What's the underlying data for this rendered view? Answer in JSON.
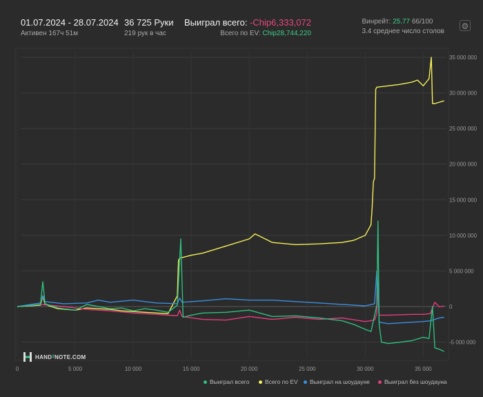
{
  "header": {
    "date_range": "01.07.2024 - 28.07.2024",
    "active_time": "Активен 167ч 51м",
    "hands_count": "36 725 Руки",
    "hands_per_hour": "219 рук в час",
    "won_total_label": "Выиграл всего: ",
    "won_total_value": "-Chip6,333,072",
    "ev_total_label": "Всего по EV: ",
    "ev_total_value": "Chip28,744,220",
    "winrate_label": "Винрейт: ",
    "winrate_value": "25.77",
    "winrate_suffix": " 66/100",
    "avg_tables": "3.4 среднее число столов"
  },
  "logo": {
    "text_a": "HAND",
    "text_b": "2",
    "text_c": "NOTE.COM"
  },
  "colors": {
    "won_total": "#2fbf7f",
    "ev_total": "#f5f05a",
    "showdown": "#3b8fe0",
    "non_showdown": "#e63d7d"
  },
  "icons": {
    "settings": "gear-icon"
  },
  "chart_data": {
    "type": "line",
    "xlim": [
      0,
      37000
    ],
    "ylim": [
      -6000000,
      35000000
    ],
    "x_ticks": [
      "0",
      "5 000",
      "10 000",
      "15 000",
      "20 000",
      "25 000",
      "30 000",
      "35 000"
    ],
    "x_tick_values": [
      0,
      5000,
      10000,
      15000,
      20000,
      25000,
      30000,
      35000
    ],
    "y_ticks": [
      "35 000 000",
      "30 000 000",
      "25 000 000",
      "20 000 000",
      "15 000 000",
      "10 000 000",
      "5 000 000",
      "0",
      "-5 000 000"
    ],
    "y_tick_values": [
      35000000,
      30000000,
      25000000,
      20000000,
      15000000,
      10000000,
      5000000,
      0,
      -5000000
    ],
    "grid": true,
    "legend_position": "bottom-right",
    "series": [
      {
        "name": "Выиграл всего",
        "color": "#2fbf7f",
        "x": [
          0,
          1500,
          2000,
          2200,
          2400,
          3500,
          5000,
          6000,
          8000,
          9000,
          10000,
          11000,
          12000,
          13000,
          13800,
          14100,
          14300,
          15000,
          16000,
          18000,
          20000,
          22000,
          24000,
          26000,
          28000,
          29000,
          30000,
          30500,
          31000,
          31100,
          31200,
          31400,
          32000,
          33000,
          34000,
          35000,
          35500,
          35800,
          36000,
          36400,
          36800
        ],
        "y": [
          0,
          200000,
          300000,
          3500000,
          400000,
          -200000,
          -500000,
          300000,
          -300000,
          -200000,
          -600000,
          -300000,
          -500000,
          -800000,
          200000,
          9500000,
          -1500000,
          -1200000,
          -900000,
          -800000,
          -500000,
          -1400000,
          -1300000,
          -1600000,
          -2000000,
          -2500000,
          -3200000,
          -3500000,
          200000,
          12000000,
          -2500000,
          -5000000,
          -5200000,
          -5000000,
          -4800000,
          -4300000,
          -4500000,
          0,
          -5800000,
          -6000000,
          -6300000
        ]
      },
      {
        "name": "Всего по EV",
        "color": "#f5f05a",
        "x": [
          0,
          1500,
          2000,
          2200,
          2400,
          3500,
          5000,
          6000,
          8000,
          9000,
          10000,
          11000,
          12000,
          13000,
          13800,
          13900,
          14000,
          15000,
          16000,
          18000,
          20000,
          20500,
          21000,
          22000,
          24000,
          26000,
          28000,
          29000,
          30000,
          30500,
          30600,
          30700,
          30800,
          30900,
          31000,
          32000,
          33000,
          34000,
          34500,
          35000,
          35500,
          35700,
          35800,
          36000,
          36400,
          36800
        ],
        "y": [
          0,
          150000,
          200000,
          1500000,
          300000,
          -300000,
          -500000,
          -200000,
          -400000,
          -600000,
          -700000,
          -800000,
          -900000,
          -1000000,
          1500000,
          6500000,
          6800000,
          7200000,
          7500000,
          8500000,
          9500000,
          10200000,
          9800000,
          9000000,
          8700000,
          8800000,
          9000000,
          9300000,
          10000000,
          11500000,
          14000000,
          17500000,
          18000000,
          30500000,
          30800000,
          31000000,
          31200000,
          31500000,
          31800000,
          31000000,
          32000000,
          35000000,
          28500000,
          28500000,
          28700000,
          28900000
        ]
      },
      {
        "name": "Выиграл на шоудауне",
        "color": "#3b8fe0",
        "x": [
          0,
          2000,
          2200,
          2400,
          4000,
          6000,
          7000,
          8000,
          10000,
          11000,
          12000,
          13800,
          14000,
          14200,
          16000,
          18000,
          20000,
          22000,
          24000,
          26000,
          28000,
          30000,
          30800,
          31000,
          31100,
          31200,
          32000,
          34000,
          35000,
          35600,
          36000,
          36400,
          36800
        ],
        "y": [
          0,
          500000,
          1500000,
          700000,
          400000,
          500000,
          900000,
          600000,
          900000,
          700000,
          500000,
          400000,
          1200000,
          600000,
          800000,
          1100000,
          900000,
          900000,
          700000,
          500000,
          300000,
          100000,
          400000,
          5000000,
          2800000,
          -2200000,
          -2400000,
          -2200000,
          -2100000,
          -2000000,
          -1800000,
          -1600000,
          -1500000
        ]
      },
      {
        "name": "Выиграл без шоудауна",
        "color": "#e63d7d",
        "x": [
          0,
          2000,
          4000,
          6000,
          8000,
          10000,
          12000,
          13800,
          14000,
          14200,
          16000,
          18000,
          20000,
          22000,
          24000,
          26000,
          28000,
          30000,
          30800,
          31000,
          31100,
          31200,
          32000,
          34000,
          35000,
          35600,
          36000,
          36400,
          36800
        ],
        "y": [
          0,
          300000,
          0,
          -400000,
          -600000,
          -900000,
          -1100000,
          -1300000,
          -500000,
          -1400000,
          -1800000,
          -1900000,
          -1400000,
          -1800000,
          -1500000,
          -1800000,
          -1600000,
          -2100000,
          -1900000,
          -1000000,
          3000000,
          -1200000,
          -1200000,
          -1100000,
          -1100000,
          -1000000,
          600000,
          -50000,
          100000
        ]
      }
    ]
  }
}
